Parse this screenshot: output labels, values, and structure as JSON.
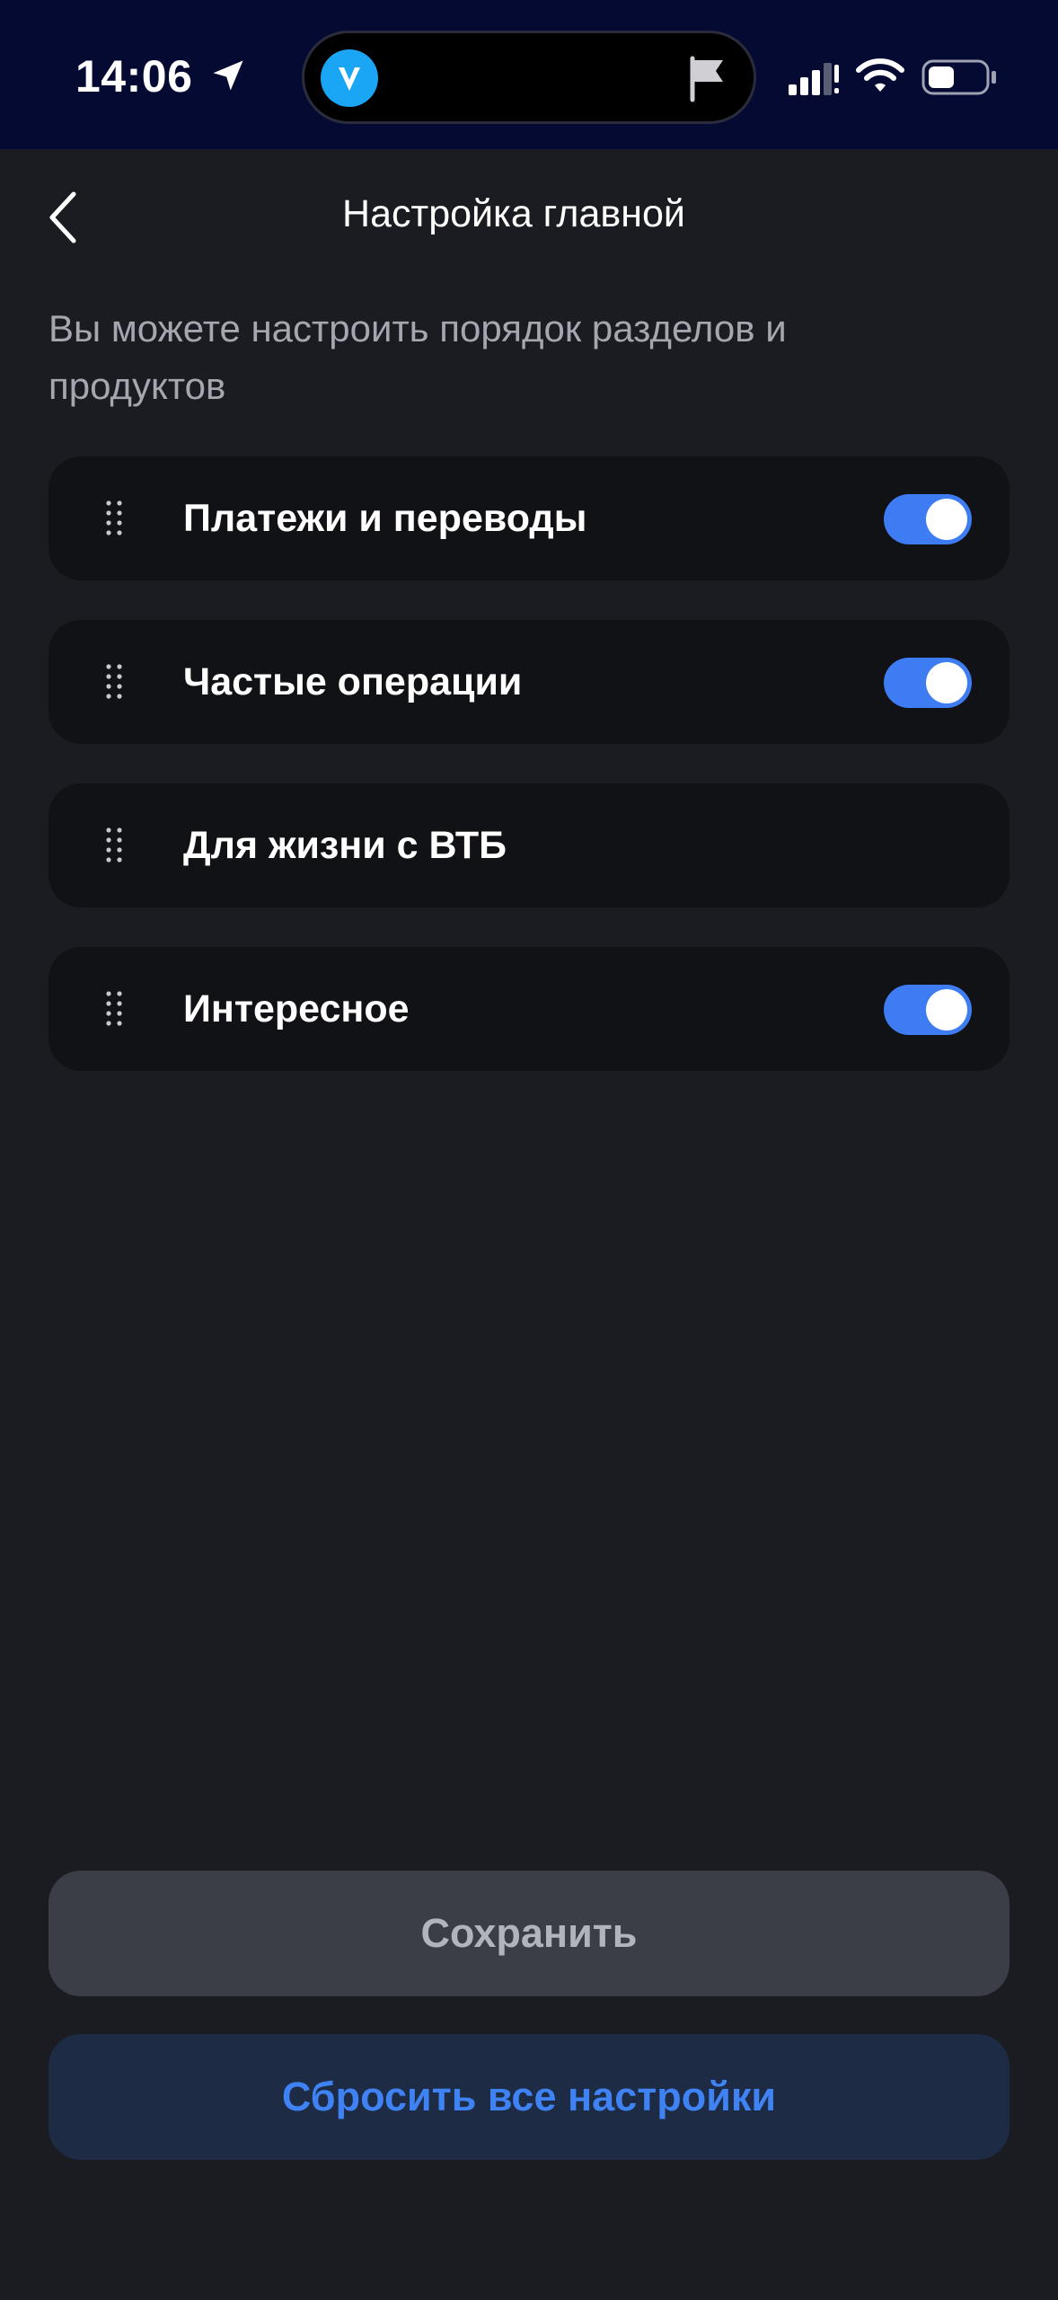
{
  "status_bar": {
    "time": "14:06",
    "icons": [
      "location-arrow-icon",
      "vtb-app-icon",
      "flag-icon",
      "cellular-signal-icon",
      "wifi-icon",
      "battery-icon"
    ]
  },
  "header": {
    "back_icon": "chevron-left-icon",
    "title": "Настройка главной"
  },
  "description": "Вы можете настроить порядок разделов и продуктов",
  "sections": [
    {
      "label": "Платежи и переводы",
      "toggle_visible": true,
      "enabled": true
    },
    {
      "label": "Частые операции",
      "toggle_visible": true,
      "enabled": true
    },
    {
      "label": "Для жизни с ВТБ",
      "toggle_visible": false,
      "enabled": null
    },
    {
      "label": "Интересное",
      "toggle_visible": true,
      "enabled": true
    }
  ],
  "actions": {
    "save_label": "Сохранить",
    "reset_label": "Сбросить все настройки"
  },
  "colors": {
    "background": "#1b1c21",
    "status_bar": "#050a33",
    "card": "#111216",
    "accent": "#3d7cf2",
    "save_button": "#3b3d47",
    "reset_button": "#1e2b45"
  }
}
